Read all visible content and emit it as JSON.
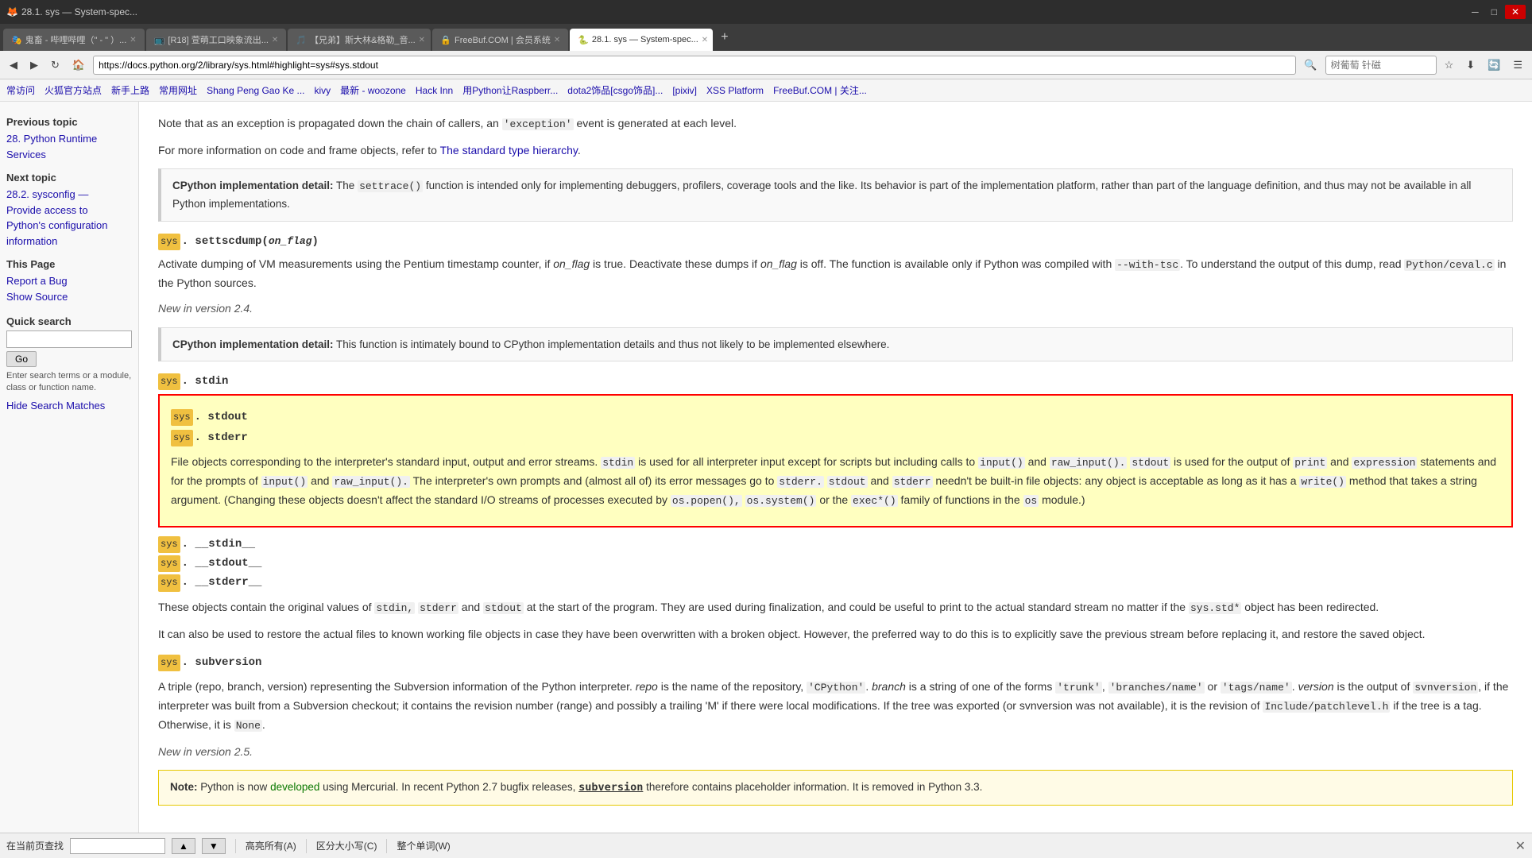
{
  "browser": {
    "title": "28.1. sys — System-spec...",
    "tabs": [
      {
        "label": "鬼畜 - 哔哩哔哩（\" - \" ）...",
        "active": false
      },
      {
        "label": "[R18] 萱萌工口映象流出...",
        "active": false
      },
      {
        "label": "【兄弟】斯大林&格勒_音...",
        "active": false
      },
      {
        "label": "FreeBuf.COM | 会员系统",
        "active": false
      },
      {
        "label": "28.1. sys — System-spec...",
        "active": true
      }
    ],
    "url": "https://docs.python.org/2/library/sys.html#highlight=sys#sys.stdout",
    "search_placeholder": "树葡萄 针磁"
  },
  "bookmarks": [
    "常访问",
    "火狐官方站点",
    "新手上路",
    "常用网址",
    "Shang Peng Gao Ke ...",
    "kivy",
    "最新 - woozone",
    "Hack Inn",
    "用Python让Raspberr...",
    "dota2饰品[csgo饰品]...",
    "[pixiv]",
    "XSS Platform",
    "FreeBuf.COM | 关注..."
  ],
  "sidebar": {
    "previous_topic_label": "Previous topic",
    "previous_topic_link": "28. Python Runtime Services",
    "next_topic_label": "Next topic",
    "next_topic_link": "28.2. sysconfig — Provide access to Python's configuration information",
    "this_page_label": "This Page",
    "report_bug": "Report a Bug",
    "show_source": "Show Source",
    "quick_search_label": "Quick search",
    "search_input_placeholder": "",
    "go_button": "Go",
    "search_hint": "Enter search terms or a module, class or function name.",
    "hide_search": "Hide Search Matches"
  },
  "content": {
    "para1": "Note that as an exception is propagated down the chain of callers, an",
    "exception_code": "'exception'",
    "para1b": "event is generated at each level.",
    "para2_pre": "For more information on code and frame objects, refer to",
    "para2_link": "The standard type hierarchy",
    "para2_post": ".",
    "cpython1_strong": "CPython implementation detail:",
    "cpython1_text": "The",
    "settrace_code": "settrace()",
    "cpython1_rest": "function is intended only for implementing debuggers, profilers, coverage tools and the like. Its behavior is part of the implementation platform, rather than part of the language definition, and thus may not be available in all Python implementations.",
    "settscdump_sig": "sys.settscdump(on_flag)",
    "settscdump_sys": "sys",
    "settscdump_name": "settscdump",
    "settscdump_arg": "on_flag",
    "settscdump_desc1_pre": "Activate dumping of VM measurements using the Pentium timestamp counter, if",
    "on_flag_em": "on_flag",
    "settscdump_desc1_mid": "is true. Deactivate these dumps if",
    "on_flag_em2": "on_flag",
    "settscdump_desc1_rest": "is off. The function is available only if Python was compiled with",
    "with_tsc_code": "--with-tsc",
    "settscdump_desc1_end": ". To understand the output of this dump, read",
    "python_ceval_code": "Python/ceval.c",
    "settscdump_desc1_final": "in the Python sources.",
    "new_version_244": "New in version 2.4.",
    "cpython2_strong": "CPython implementation detail:",
    "cpython2_text": "This function is intimately bound to CPython implementation details and thus not likely to be implemented elsewhere.",
    "stdin_sys": "sys",
    "stdin_name": "stdin",
    "stdout_sys": "sys",
    "stdout_name": "stdout",
    "stderr_sys": "sys",
    "stderr_name": "stderr",
    "streams_desc_pre": "File objects corresponding to the interpreter's standard input, output and error streams.",
    "stdin_code": "stdin",
    "streams_desc1": "is used for all interpreter input except for scripts but including calls to",
    "input_code": "input()",
    "and": "and",
    "raw_input_code": "raw_input().",
    "stdout_code": "stdout",
    "streams_desc2": "is used for the output of",
    "print_code": "print",
    "and2": "and",
    "expression_code": "expression",
    "streams_desc3": "statements and for the prompts of",
    "input2_code": "input()",
    "and3": "and",
    "raw_input2_code": "raw_input().",
    "streams_desc4": "The interpreter's own prompts and (almost all of) its error messages go to",
    "stderr_code": "stderr.",
    "stdout_code2": "stdout",
    "and4": "and",
    "stderr_code2": "stderr",
    "streams_desc5": "needn't be built-in file objects: any object is acceptable as long as it has a",
    "write_code": "write()",
    "streams_desc6": "method that takes a string argument. (Changing these objects doesn't affect the standard I/O streams of processes executed by",
    "os_popen_code": "os.popen(),",
    "os_system_code": "os.system()",
    "streams_desc7": "or the",
    "exec_code": "exec*()",
    "streams_desc8": "family of functions in the",
    "os_code": "os",
    "streams_desc9": "module.)",
    "stdin_private_sys": "sys",
    "stdin_private_name": "__stdin__",
    "stdout_private_sys": "sys",
    "stdout_private_name": "__stdout__",
    "stderr_private_sys": "sys",
    "stderr_private_name": "__stderr__",
    "private_desc1_pre": "These objects contain the original values of",
    "stdin_orig": "stdin,",
    "stderr_orig": "stderr",
    "and5": "and",
    "stdout_orig": "stdout",
    "private_desc1_mid": "at the start of the program. They are used during finalization, and could be useful to print to the actual standard stream no matter if the",
    "sys_std_code": "sys.std*",
    "private_desc1_end": "object has been redirected.",
    "private_desc2": "It can also be used to restore the actual files to known working file objects in case they have been overwritten with a broken object. However, the preferred way to do this is to explicitly save the previous stream before replacing it, and restore the saved object.",
    "subversion_sys": "sys",
    "subversion_name": "subversion",
    "subversion_desc1_pre": "A triple (repo, branch, version) representing the Subversion information of the Python interpreter.",
    "repo_em": "repo",
    "subversion_desc1a": "is the name of the repository,",
    "cpython_code": "'CPython'",
    "subversion_desc1b": ".",
    "branch_em": "branch",
    "subversion_desc1c": "is a string of one of the forms",
    "trunk_code": "'trunk'",
    "comma": ",",
    "branches_code": "'branches/name'",
    "or_text": "or",
    "tags_code": "'tags/name'",
    "subversion_desc1d": ".",
    "version_em": "version",
    "subversion_desc1e": "is the output of",
    "svnversion_code": "svnversion",
    "subversion_desc1f": ", if the interpreter was built from a Subversion checkout; it contains the revision number (range) and possibly a trailing",
    "M_code": "'M'",
    "subversion_desc1g": "if there were local modifications. If the tree was exported (or svnversion was not available), it is the revision of",
    "include_patchlevel": "Include/patchlevel.h",
    "subversion_desc1h": "if the tree is a tag. Otherwise, it is",
    "none_code": "None",
    "subversion_desc1i": ".",
    "new_version_25": "New in version 2.5.",
    "note_strong": "Note:",
    "note_text": "Python is now",
    "developed_link": "developed",
    "note_text2": "using Mercurial. In recent Python 2.7 bugfix releases,",
    "subversion_code_note": "subversion",
    "note_text3": "therefore contains placeholder information. It is removed in Python 3.3."
  },
  "bottom_bar": {
    "label": "在当前页查找",
    "highlight_all": "高亮所有(A)",
    "match_case": "区分大小写(C)",
    "whole_word": "整个单词(W)"
  }
}
